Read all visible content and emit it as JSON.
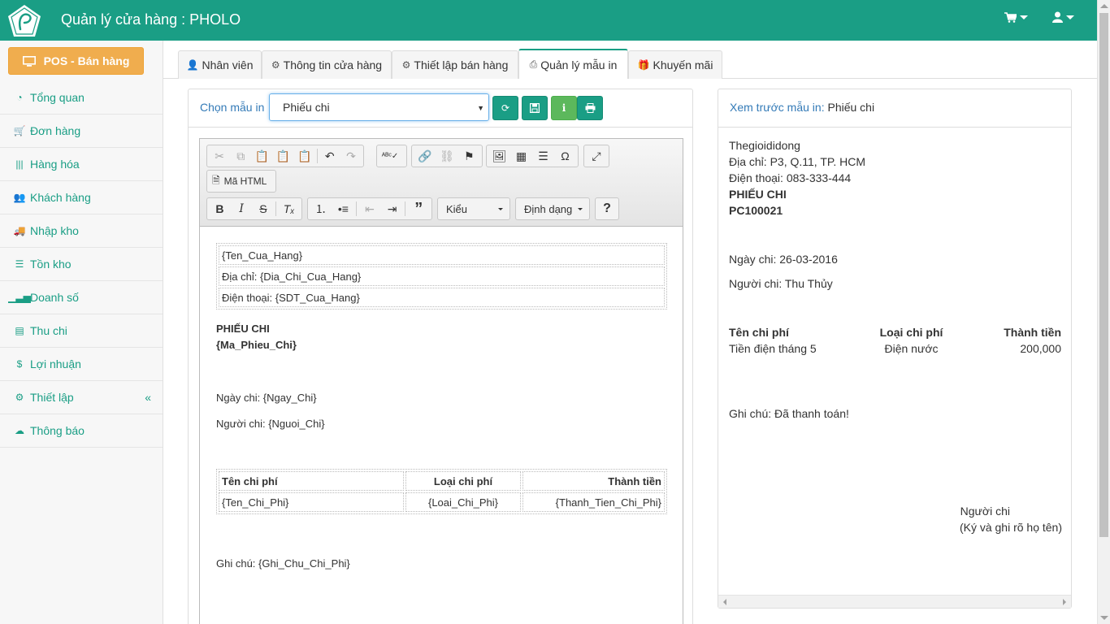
{
  "app": {
    "title": "Quản lý cửa hàng : PHOLO"
  },
  "sidebar": {
    "pos_button": "POS - Bán hàng",
    "items": [
      {
        "label": "Tổng quan",
        "icon": "dashboard-icon"
      },
      {
        "label": "Đơn hàng",
        "icon": "cart-icon"
      },
      {
        "label": "Hàng hóa",
        "icon": "barcode-icon"
      },
      {
        "label": "Khách hàng",
        "icon": "users-icon"
      },
      {
        "label": "Nhập kho",
        "icon": "truck-icon"
      },
      {
        "label": "Tồn kho",
        "icon": "list-icon"
      },
      {
        "label": "Doanh số",
        "icon": "signal-icon"
      },
      {
        "label": "Thu chi",
        "icon": "file-icon"
      },
      {
        "label": "Lợi nhuận",
        "icon": "dollar-icon"
      },
      {
        "label": "Thiết lập",
        "icon": "gears-icon"
      },
      {
        "label": "Thông báo",
        "icon": "cloud-icon"
      }
    ]
  },
  "tabs": [
    {
      "label": "Nhân viên"
    },
    {
      "label": "Thông tin cửa hàng"
    },
    {
      "label": "Thiết lập bán hàng"
    },
    {
      "label": "Quản lý mẫu in"
    },
    {
      "label": "Khuyến mãi"
    }
  ],
  "editor_panel": {
    "choose_label": "Chọn mẫu in",
    "selected_template": "Phiếu chi",
    "html_button": "Mã HTML",
    "style_dropdown": "Kiểu",
    "format_dropdown": "Định dạng",
    "content": {
      "store_name": "{Ten_Cua_Hang}",
      "address": "Địa chỉ: {Dia_Chi_Cua_Hang}",
      "phone": "Điện thoại: {SDT_Cua_Hang}",
      "doc_title": "PHIẾU CHI",
      "doc_code": "{Ma_Phieu_Chi}",
      "date": "Ngày chi: {Ngay_Chi}",
      "payer": "Người chi: {Nguoi_Chi}",
      "table_headers": [
        "Tên chi phí",
        "Loại chi phí",
        "Thành tiền"
      ],
      "table_row": [
        "{Ten_Chi_Phi}",
        "{Loai_Chi_Phi}",
        "{Thanh_Tien_Chi_Phi}"
      ],
      "note": "Ghi chú: {Ghi_Chu_Chi_Phi}"
    }
  },
  "preview_panel": {
    "title_label": "Xem trước mẫu in:",
    "title_value": "Phiếu chi",
    "store_name": "Thegioididong",
    "address": "Địa chỉ: P3, Q.11, TP. HCM",
    "phone": "Điện thoại: 083-333-444",
    "doc_title": "PHIẾU CHI",
    "doc_code": "PC100021",
    "date": "Ngày chi: 26-03-2016",
    "payer": "Người chi: Thu Thủy",
    "table_headers": [
      "Tên chi phí",
      "Loại chi phí",
      "Thành tiền"
    ],
    "table_row": [
      "Tiền điện tháng 5",
      "Điện nước",
      "200,000"
    ],
    "note": "Ghi chú: Đã thanh toán!",
    "signature_title": "Người chi",
    "signature_hint": "(Ký và ghi rõ họ tên)"
  }
}
